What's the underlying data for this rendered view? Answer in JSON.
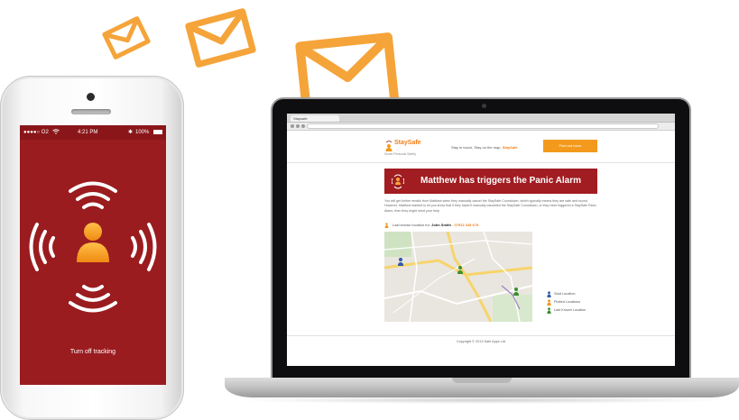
{
  "colors": {
    "envelope": "#f5a43a",
    "phone_screen": "#9a1c1f",
    "alert_banner": "#a11d22",
    "brand_orange": "#f07e1c",
    "cta_orange": "#f39a1c",
    "pin_blue": "#2e5aa8",
    "pin_orange": "#f0961c",
    "pin_green": "#3a8f2f"
  },
  "envelopes": [
    {
      "name": "envelope-small",
      "icon": "envelope-icon"
    },
    {
      "name": "envelope-medium",
      "icon": "envelope-icon"
    },
    {
      "name": "envelope-large",
      "icon": "envelope-icon"
    }
  ],
  "phone": {
    "status": {
      "carrier": "●●●●○ O2",
      "wifi_icon": "wifi-icon",
      "time": "4:21 PM",
      "bluetooth_icon": "bluetooth-icon",
      "battery": "100%"
    },
    "graphic_icon": "person-broadcasting-icon",
    "turn_off_label": "Turn off tracking"
  },
  "browser": {
    "tab_title": "Staysafe"
  },
  "site": {
    "logo_text": "StaySafe",
    "logo_tag": "Smart Personal Safety",
    "tagline_prefix": "Stay in touch, Stay on the map, ",
    "tagline_brand": "StaySafe",
    "cta_label": "Find out more",
    "alert_title": "Matthew has triggers the Panic Alarm",
    "alert_body": "You will get further emails from Matthew when they manually cancel the StaySafe Countdown, which typically means they are safe and sound. However, Matthew wanted to let you know that if they haven't manually cancelled the StaySafe Countdown, or they have triggered a StaySafe Panic Alarm, then they might need your help.",
    "last_known_prefix": "Last known location for: ",
    "last_known_name": "John Smith",
    "last_known_sep": " - ",
    "last_known_phone": "07912 345 678",
    "legend": [
      {
        "label": "Start Location",
        "pin": "pin_blue"
      },
      {
        "label": "Plotted Locations",
        "pin": "pin_orange"
      },
      {
        "label": "Last Known Location",
        "pin": "pin_green"
      }
    ],
    "footer": "Copyright © 2013 Safe Apps Ltd"
  }
}
